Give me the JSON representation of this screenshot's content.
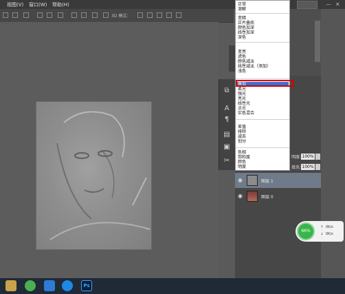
{
  "menubar": {
    "items": [
      "视图(V)",
      "窗口(W)",
      "帮助(H)"
    ]
  },
  "options_bar": {
    "mode_label": "3D 模式："
  },
  "blend_menu": {
    "groups": [
      [
        "正常",
        "溶解"
      ],
      [
        "变暗",
        "正片叠底",
        "颜色加深",
        "线性加深",
        "深色"
      ],
      [
        "变亮",
        "滤色",
        "颜色减淡",
        "线性减淡（添加）",
        "浅色"
      ],
      [
        "叠加",
        "柔光",
        "强光",
        "亮光",
        "线性光",
        "点光",
        "实色混合"
      ],
      [
        "差值",
        "排除",
        "减去",
        "划分"
      ],
      [
        "色相",
        "饱和度",
        "颜色",
        "明度"
      ]
    ],
    "selected": "叠加"
  },
  "layer_options": {
    "opacity_label": "明度:",
    "opacity_value": "100%",
    "fill_label": "填充:",
    "fill_value": "100%"
  },
  "layers": [
    {
      "name": "图层 1",
      "selected": true
    },
    {
      "name": "图层 0",
      "selected": false
    }
  ],
  "perf_widget": {
    "cpu_percent": "66%",
    "up_label": "↑",
    "up_value": "0K/s",
    "down_label": "↓",
    "down_value": "0K/s"
  },
  "taskbar": {
    "app_label": "Ps"
  },
  "colors": {
    "highlight": "#3a6fd1",
    "outline": "#d60000",
    "perf_green": "#39b54a"
  }
}
